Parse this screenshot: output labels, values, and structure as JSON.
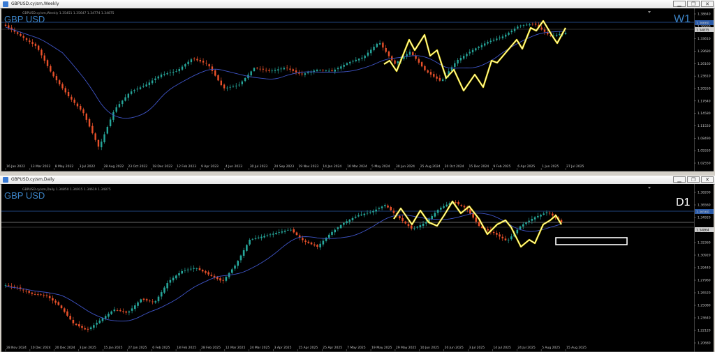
{
  "colors": {
    "bull": "#26a69a",
    "bear": "#e8502a",
    "ma": "#3f55c8",
    "zigzag_outer": "#f4e20d",
    "zigzag_inner": "#ffffff",
    "grid_line": "#2a5aa8",
    "price_box_bg": "#2a5aa8"
  },
  "window_buttons": {
    "minimize": "▁",
    "restore": "❐",
    "close": "✕"
  },
  "weekly": {
    "window_title": "GBPUSD.cy/sm,Weekly",
    "symbol": "GBP USD",
    "ohlc": "GBPUSD.cy/sm,Weekly  1.35451 1.35647 1.34774 1.34875",
    "timeframe": "W1",
    "timeframe_color": "#3b82c4",
    "current_price": "1.34875",
    "hline_price": "1.36660",
    "price_ticks": [
      "1.38640",
      "1.36660",
      "1.33610",
      "1.29680",
      "1.26160",
      "1.23610",
      "1.20550",
      "1.17640",
      "1.14580",
      "1.11520",
      "1.08490",
      "1.05550",
      "1.02550"
    ],
    "date_ticks": [
      "16 Jan 2022",
      "13 Mar 2022",
      "8 May 2022",
      "3 Jul 2022",
      "28 Aug 2022",
      "23 Oct 2022",
      "18 Dec 2022",
      "12 Feb 2023",
      "9 Apr 2023",
      "4 Jun 2023",
      "30 Jul 2023",
      "24 Sep 2023",
      "19 Nov 2023",
      "14 Jan 2024",
      "10 Mar 2024",
      "5 May 2024",
      "30 Jun 2024",
      "25 Aug 2024",
      "20 Oct 2024",
      "15 Dec 2024",
      "9 Feb 2025",
      "6 Apr 2025",
      "1 Jun 2025",
      "27 Jul 2025"
    ]
  },
  "daily": {
    "window_title": "GBPUSD.cy/sm,Daily",
    "symbol": "GBP USD",
    "ohlc": "GBPUSD.cy/sm,Daily  1.34850 1.34915 1.34619 1.34875",
    "timeframe": "D1",
    "timeframe_color": "#ffffff",
    "current_price": "1.34864",
    "hline_price": "1.36560",
    "price_ticks": [
      "1.38200",
      "1.36560",
      "1.34920",
      "1.33640",
      "1.32360",
      "1.30920",
      "1.29440",
      "1.27960",
      "1.26520",
      "1.25080",
      "1.23640",
      "1.22120",
      "1.20680"
    ],
    "date_ticks": [
      "28 Nov 2024",
      "10 Dec 2024",
      "20 Dec 2024",
      "3 Jan 2025",
      "15 Jan 2025",
      "27 Jan 2025",
      "6 Feb 2025",
      "18 Feb 2025",
      "28 Feb 2025",
      "12 Mar 2025",
      "24 Mar 2025",
      "3 Apr 2025",
      "15 Apr 2025",
      "25 Apr 2025",
      "7 May 2025",
      "19 May 2025",
      "29 May 2025",
      "10 Jun 2025",
      "20 Jun 2025",
      "3 Jul 2025",
      "14 Jul 2025",
      "24 Jul 2025",
      "5 Aug 2025",
      "15 Aug 2025"
    ]
  }
}
